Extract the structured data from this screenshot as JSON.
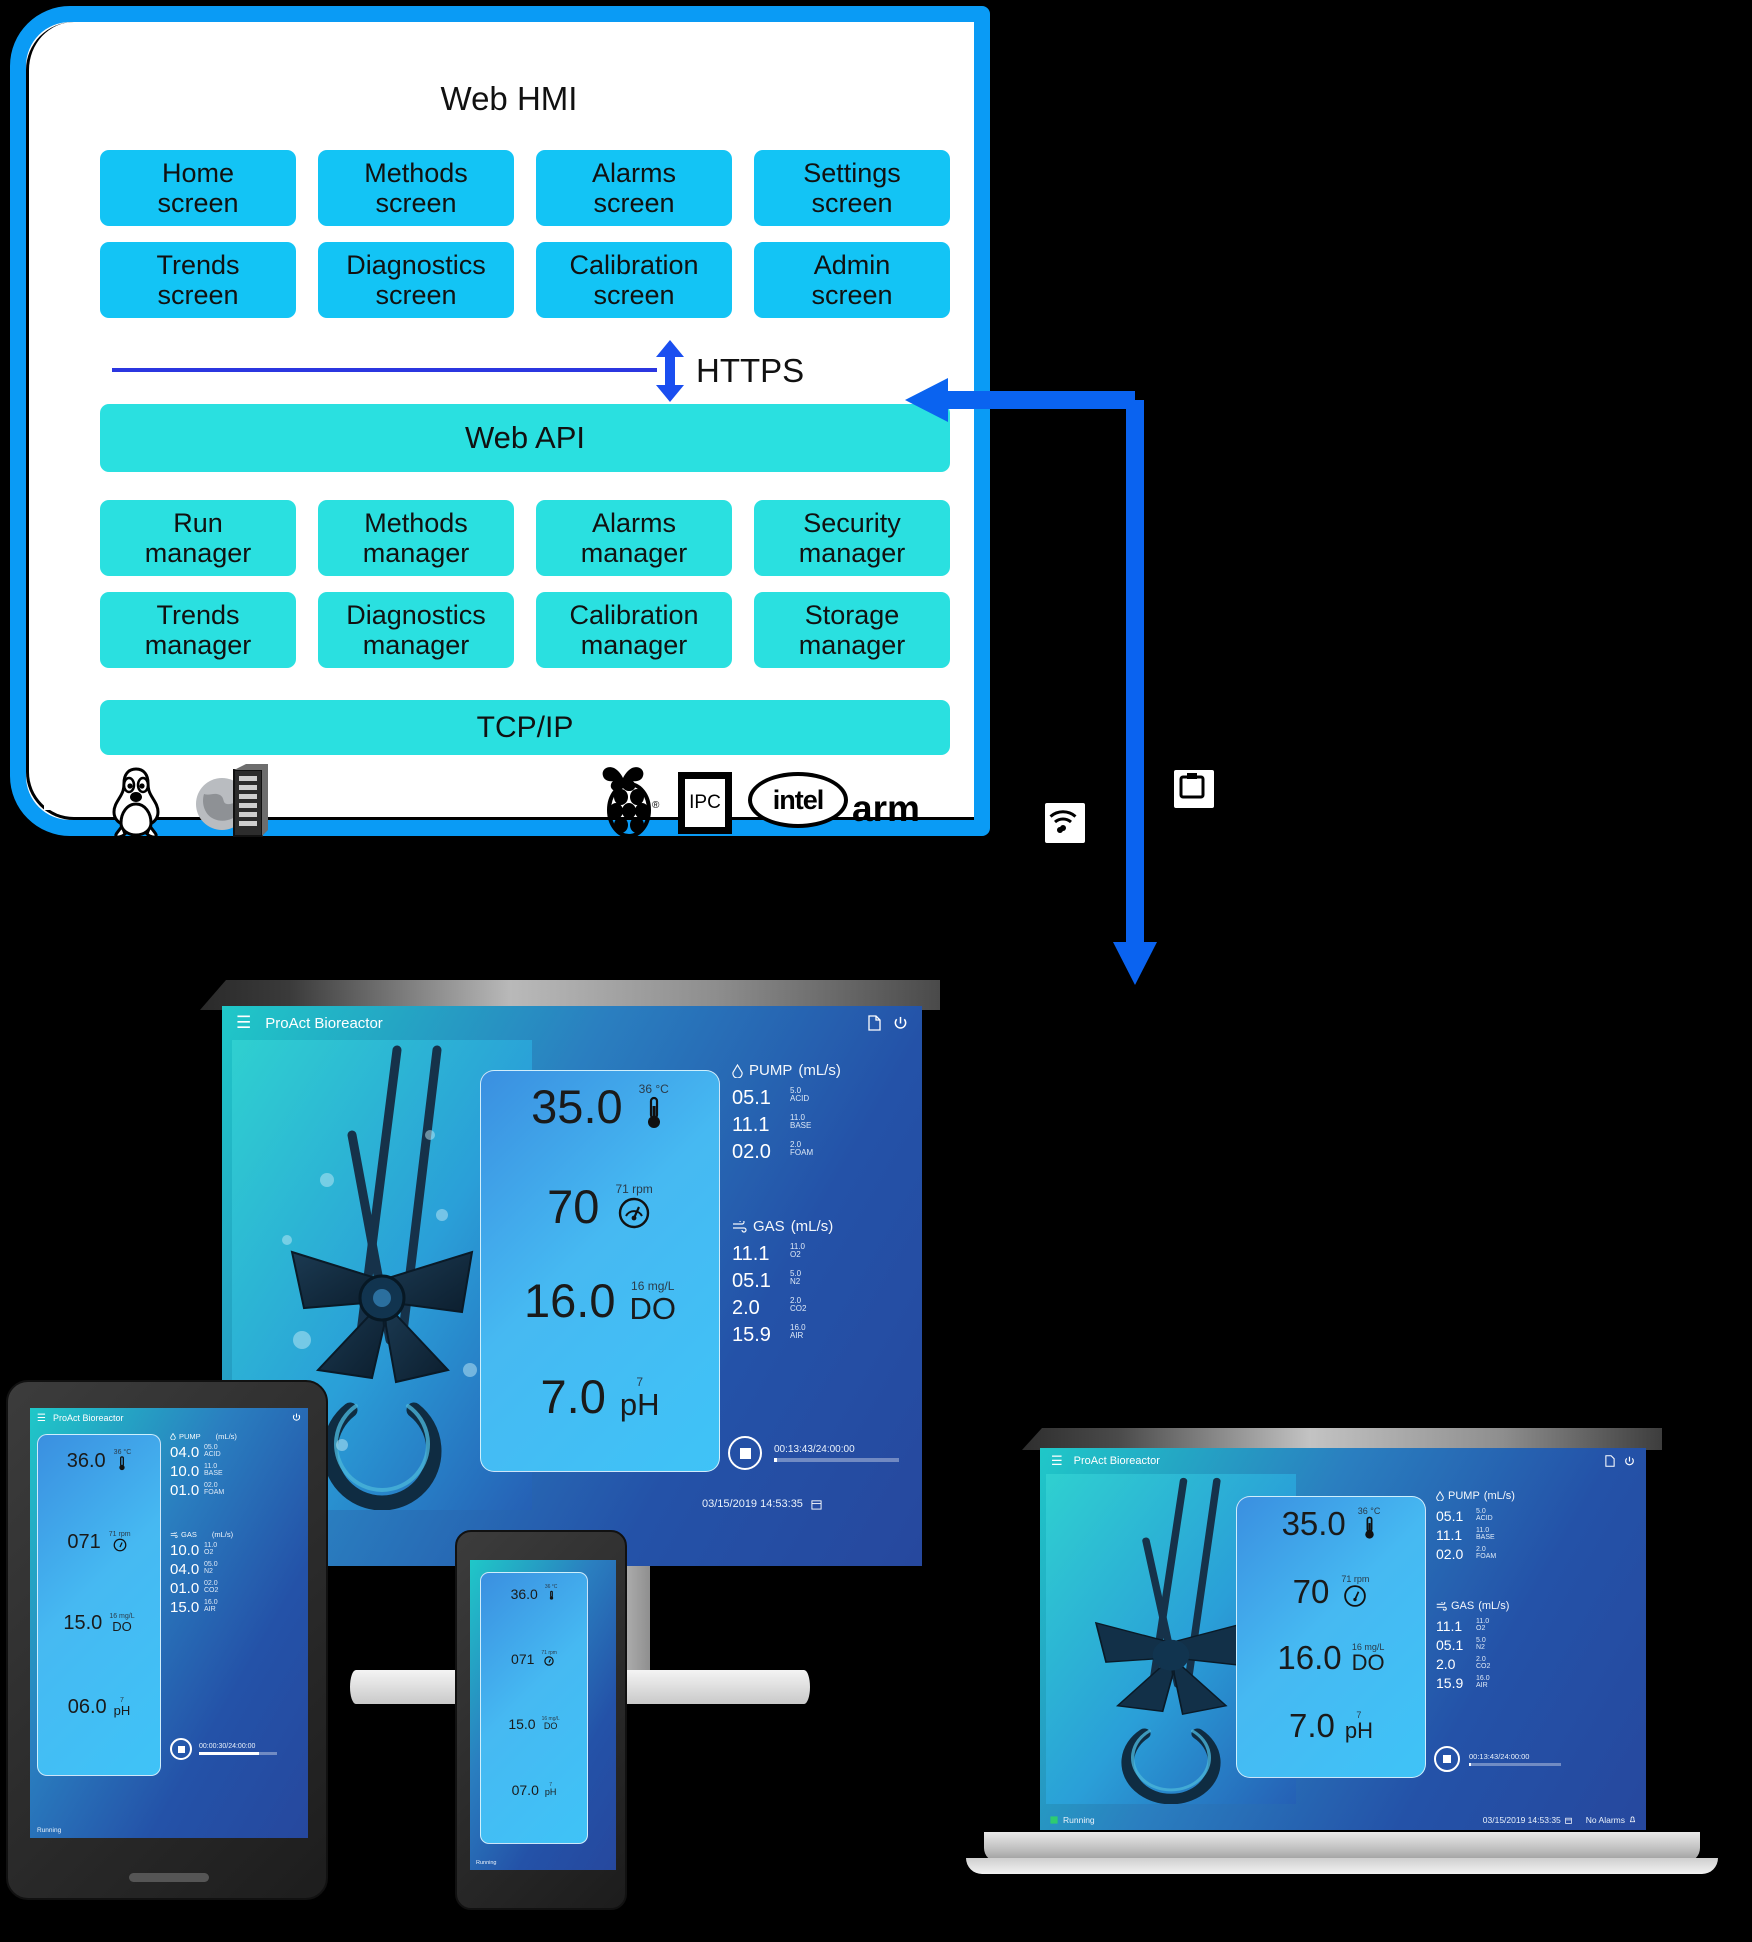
{
  "architecture": {
    "title": "Web HMI",
    "screens": [
      {
        "line1": "Home",
        "line2": "screen"
      },
      {
        "line1": "Methods",
        "line2": "screen"
      },
      {
        "line1": "Alarms",
        "line2": "screen"
      },
      {
        "line1": "Settings",
        "line2": "screen"
      },
      {
        "line1": "Trends",
        "line2": "screen"
      },
      {
        "line1": "Diagnostics",
        "line2": "screen"
      },
      {
        "line1": "Calibration",
        "line2": "screen"
      },
      {
        "line1": "Admin",
        "line2": "screen"
      }
    ],
    "protocol_label": "HTTPS",
    "web_api_label": "Web API",
    "managers": [
      {
        "line1": "Run",
        "line2": "manager"
      },
      {
        "line1": "Methods",
        "line2": "manager"
      },
      {
        "line1": "Alarms",
        "line2": "manager"
      },
      {
        "line1": "Security",
        "line2": "manager"
      },
      {
        "line1": "Trends",
        "line2": "manager"
      },
      {
        "line1": "Diagnostics",
        "line2": "manager"
      },
      {
        "line1": "Calibration",
        "line2": "manager"
      },
      {
        "line1": "Storage",
        "line2": "manager"
      }
    ],
    "transport_label": "TCP/IP",
    "platform_logos": [
      {
        "name": "linux-tux-logo",
        "text": ""
      },
      {
        "name": "server-rack-logo",
        "text": ""
      },
      {
        "name": "raspberry-pi-logo",
        "text": ""
      },
      {
        "name": "ipc-logo",
        "text": "IPC"
      },
      {
        "name": "intel-logo",
        "text": "intel"
      },
      {
        "name": "arm-logo",
        "text": "arm"
      }
    ],
    "network_icons": [
      {
        "name": "wifi-icon"
      },
      {
        "name": "ethernet-port-icon"
      }
    ],
    "colors": {
      "outer_border": "#0a9bf5",
      "screen_tile": "#13c4f5",
      "manager_tile": "#2ae0e0",
      "https_line": "#2b36e0",
      "arrow": "#0a63f0"
    }
  },
  "hmi": {
    "app_title": "ProAct Bioreactor",
    "menu_icon": "hamburger-menu-icon",
    "doc_icon": "document-icon",
    "power_icon": "power-icon",
    "readouts": [
      {
        "value": "35.0",
        "unit": "36 °C",
        "name": "",
        "icon": "thermometer-icon"
      },
      {
        "value": "70",
        "unit": "71 rpm",
        "name": "",
        "icon": "gauge-icon"
      },
      {
        "value": "16.0",
        "unit": "16 mg/L",
        "name": "DO",
        "icon": ""
      },
      {
        "value": "7.0",
        "unit": "7",
        "name": "pH",
        "icon": ""
      }
    ],
    "pump": {
      "icon": "water-drop-icon",
      "title": "PUMP",
      "units": "(mL/s)",
      "rows": [
        {
          "value": "05.1",
          "sp": "5.0",
          "label": "ACID"
        },
        {
          "value": "11.1",
          "sp": "11.0",
          "label": "BASE"
        },
        {
          "value": "02.0",
          "sp": "2.0",
          "label": "FOAM"
        }
      ]
    },
    "gas": {
      "icon": "gas-flow-icon",
      "title": "GAS",
      "units": "(mL/s)",
      "rows": [
        {
          "value": "11.1",
          "sp": "11.0",
          "label": "O2"
        },
        {
          "value": "05.1",
          "sp": "5.0",
          "label": "N2"
        },
        {
          "value": "2.0",
          "sp": "2.0",
          "label": "CO2"
        },
        {
          "value": "15.9",
          "sp": "16.0",
          "label": "AIR"
        }
      ]
    },
    "stop_icon": "stop-button-icon",
    "run_time": "00:13:43/24:00:00",
    "progress_pct": 1,
    "timestamp": "03/15/2019 14:53:35",
    "calendar_icon": "calendar-icon",
    "status_text": "Running",
    "status_icon": "running-icon",
    "alarms_text": "No Alarms",
    "alarm_icon": "bell-icon"
  },
  "tablet_hmi": {
    "app_title": "ProAct Bioreactor",
    "power_icon": "power-icon",
    "readouts": [
      {
        "value": "36.0",
        "unit": "36 °C",
        "name": "",
        "icon": "thermometer-icon"
      },
      {
        "value": "071",
        "unit": "71 rpm",
        "name": "",
        "icon": "gauge-icon"
      },
      {
        "value": "15.0",
        "unit": "16 mg/L",
        "name": "DO",
        "icon": ""
      },
      {
        "value": "06.0",
        "unit": "7",
        "name": "pH",
        "icon": ""
      }
    ],
    "pump": {
      "title": "PUMP",
      "units": "(mL/s)",
      "rows": [
        {
          "value": "04.0",
          "sp": "05.0",
          "label": "ACID"
        },
        {
          "value": "10.0",
          "sp": "11.0",
          "label": "BASE"
        },
        {
          "value": "01.0",
          "sp": "02.0",
          "label": "FOAM"
        }
      ]
    },
    "gas": {
      "title": "GAS",
      "units": "(mL/s)",
      "rows": [
        {
          "value": "10.0",
          "sp": "11.0",
          "label": "O2"
        },
        {
          "value": "04.0",
          "sp": "05.0",
          "label": "N2"
        },
        {
          "value": "01.0",
          "sp": "02.0",
          "label": "CO2"
        },
        {
          "value": "15.0",
          "sp": "16.0",
          "label": "AIR"
        }
      ]
    },
    "run_time": "00:00:30/24:00:00",
    "status_text": "Running"
  },
  "phone_hmi": {
    "app_title": "ProAct Bioreactor",
    "readouts": [
      {
        "value": "36.0",
        "unit": "36 °C"
      },
      {
        "value": "071",
        "unit": "71 rpm"
      },
      {
        "value": "15.0",
        "unit": "16 mg/L",
        "name": "DO"
      },
      {
        "value": "07.0",
        "unit": "7",
        "name": "pH"
      }
    ],
    "status_text": "Running"
  }
}
